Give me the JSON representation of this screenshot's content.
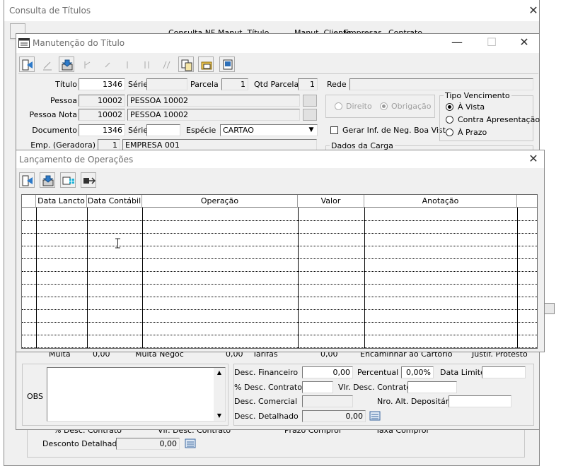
{
  "consulta": {
    "title": "Consulta de Títulos",
    "toolbar": {
      "consulta_nf": "Consulta NF",
      "manut_titulo": "Manut. Título",
      "manut_cliente": "Manut. Cliente",
      "empresas": "Empresas",
      "contrato": "Contrato"
    },
    "bottom": {
      "desc_contrato_label": "% Desc. Contrato",
      "vlr_desc_contrato_label": "Vlr. Desc. Contrato",
      "prazo_compror_label": "Prazo Compror",
      "taxa_compror_label": "Taxa Compror",
      "desconto_detalhado_label": "Desconto Detalhado",
      "desconto_detalhado_value": "0,00"
    }
  },
  "manut": {
    "title": "Manutenção do Título",
    "titulo_label": "Título",
    "titulo_value": "1346",
    "serie_label": "Série",
    "serie_value": "",
    "parcela_label": "Parcela",
    "parcela_value": "1",
    "qtd_parcela_label": "Qtd Parcela",
    "qtd_parcela_value": "1",
    "rede_label": "Rede",
    "rede_value": "",
    "pessoa_label": "Pessoa",
    "pessoa_code": "10002",
    "pessoa_name": "PESSOA 10002",
    "pessoa_nota_label": "Pessoa Nota",
    "pessoa_nota_code": "10002",
    "pessoa_nota_name": "PESSOA 10002",
    "documento_label": "Documento",
    "documento_value": "1346",
    "serie2_label": "Série",
    "serie2_value": "",
    "especie_label": "Espécie",
    "especie_value": "CARTAO",
    "emp_label": "Emp. (Geradora)",
    "emp_code": "1",
    "emp_name": "EMPRESA 001",
    "direito_label": "Direito",
    "obrigacao_label": "Obrigação",
    "gerar_inf_label": "Gerar Inf. de Neg. Boa Vist",
    "tipo_venc_label": "Tipo Vencimento",
    "a_vista_label": "À Vista",
    "contra_apres_label": "Contra Apresentação",
    "a_prazo_label": "À Prazo",
    "dados_carga_label": "Dados da Carga",
    "multa_label": "Multa",
    "multa_value": "0,00",
    "multa_negoc_label": "Multa Negoc",
    "multa_negoc_value": "0,00",
    "tarifas_label": "Tarifas",
    "tarifas_value": "0,00",
    "encaminhar_label": "Encaminhar ao Cartório",
    "justif_protesto_label": "Justif. Protesto",
    "obs_label": "OBS",
    "obs_value": "",
    "desc_financeiro_label": "Desc. Financeiro",
    "desc_financeiro_value": "0,00",
    "percentual_label": "Percentual",
    "percentual_value": "0,00%",
    "data_limite_label": "Data Limite",
    "data_limite_value": "",
    "desc_contrato_label": "% Desc. Contrato",
    "desc_contrato_value": "",
    "vlr_desc_contrato_label": "Vlr. Desc. Contrato",
    "vlr_desc_contrato_value": "",
    "desc_comercial_label": "Desc. Comercial",
    "desc_comercial_value": "",
    "nro_alt_label": "Nro. Alt. Depositário",
    "nro_alt_value": "",
    "desc_detalhado_label": "Desc. Detalhado",
    "desc_detalhado_value": "0,00"
  },
  "lanc": {
    "title": "Lançamento de Operações",
    "columns": [
      "",
      "Data Lancto",
      "Data Contábil",
      "Operação",
      "Valor",
      "Anotação",
      ""
    ],
    "rows": [
      [
        "",
        "",
        "",
        "",
        "",
        "",
        ""
      ],
      [
        "",
        "",
        "",
        "",
        "",
        "",
        ""
      ],
      [
        "",
        "",
        "",
        "",
        "",
        "",
        ""
      ],
      [
        "",
        "",
        "",
        "",
        "",
        "",
        ""
      ],
      [
        "",
        "",
        "",
        "",
        "",
        "",
        ""
      ],
      [
        "",
        "",
        "",
        "",
        "",
        "",
        ""
      ],
      [
        "",
        "",
        "",
        "",
        "",
        "",
        ""
      ],
      [
        "",
        "",
        "",
        "",
        "",
        "",
        ""
      ],
      [
        "",
        "",
        "",
        "",
        "",
        "",
        ""
      ],
      [
        "",
        "",
        "",
        "",
        "",
        "",
        ""
      ],
      [
        "",
        "",
        "",
        "",
        "",
        "",
        ""
      ]
    ]
  }
}
